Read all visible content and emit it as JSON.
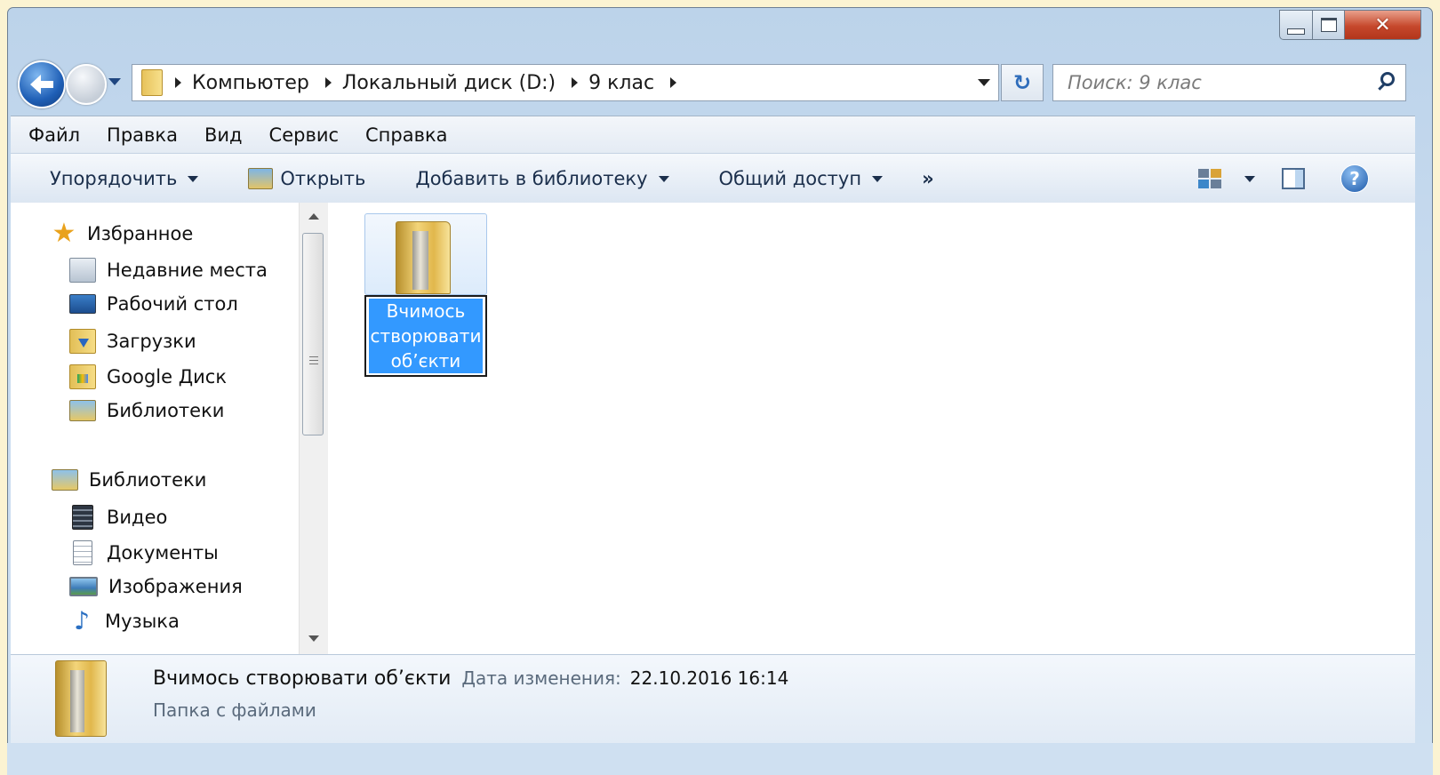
{
  "window": {
    "caption": {
      "minimize": "minimize",
      "maximize": "maximize",
      "close": "close"
    }
  },
  "address": {
    "crumbs": [
      "Компьютер",
      "Локальный диск (D:)",
      "9 клас"
    ]
  },
  "search": {
    "placeholder": "Поиск: 9 клас"
  },
  "menu": {
    "items": [
      "Файл",
      "Правка",
      "Вид",
      "Сервис",
      "Справка"
    ]
  },
  "commands": {
    "organize": "Упорядочить",
    "open": "Открыть",
    "add_to_library": "Добавить в библиотеку",
    "share": "Общий доступ",
    "more": "»",
    "help": "?"
  },
  "navpane": {
    "favorites": {
      "title": "Избранное",
      "items": [
        "Недавние места",
        "Рабочий стол",
        "Загрузки",
        "Google Диск",
        "Библиотеки"
      ]
    },
    "libraries": {
      "title": "Библиотеки",
      "items": [
        "Видео",
        "Документы",
        "Изображения",
        "Музыка"
      ]
    }
  },
  "files": [
    {
      "name": "Вчимось створювати об’єкти",
      "selected": true,
      "rename_mode": true
    }
  ],
  "details": {
    "name": "Вчимось створювати об’єкти",
    "modified_label": "Дата изменения:",
    "modified_value": "22.10.2016 16:14",
    "type": "Папка с файлами"
  },
  "colors": {
    "selection": "#3399ff",
    "chrome": "#c8dbef",
    "close_button": "#c6482c"
  }
}
